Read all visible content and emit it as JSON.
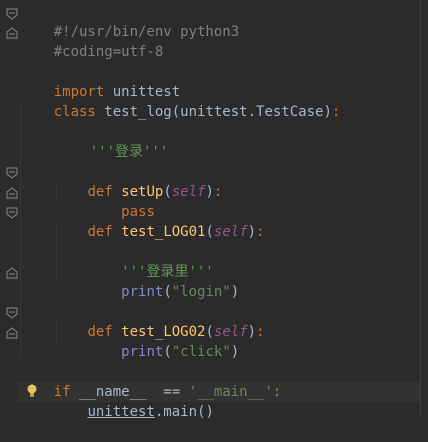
{
  "code": {
    "line1": {
      "text": "#!/usr/bin/env python3"
    },
    "line2": {
      "text": "#coding=utf-8"
    },
    "line4": {
      "kw": "import",
      "rest": " unittest"
    },
    "line5": {
      "kw": "class",
      "name": " test_log",
      "rest": "(unittest.TestCase)",
      "colon": ":"
    },
    "line7": {
      "doc": "'''登录'''"
    },
    "line9": {
      "indent": "    ",
      "kw": "def",
      "space": " ",
      "name": "setUp",
      "open": "(",
      "self": "self",
      "close": ")",
      "colon": ":"
    },
    "line10": {
      "indent": "        ",
      "kw": "pass"
    },
    "line11": {
      "indent": "    ",
      "kw": "def",
      "space": " ",
      "name": "test_LOG01",
      "open": "(",
      "self": "self",
      "close": ")",
      "colon": ":"
    },
    "line13": {
      "indent": "        ",
      "doc": "'''登录里'''"
    },
    "line14": {
      "indent": "        ",
      "builtin": "print",
      "open": "(",
      "str": "\"login\"",
      "close": ")"
    },
    "line16": {
      "indent": "    ",
      "kw": "def",
      "space": " ",
      "name": "test_LOG02",
      "open": "(",
      "self": "self",
      "close": ")",
      "colon": ":"
    },
    "line17": {
      "indent": "        ",
      "builtin": "print",
      "open": "(",
      "str": "\"click\"",
      "close": ")"
    },
    "line19": {
      "kw": "if",
      "mid": " __name__  == ",
      "str": "'__main__'",
      "colon": ":"
    },
    "line20": {
      "indent": "    ",
      "link": "unittest",
      "rest": ".main()"
    }
  },
  "colors": {
    "background": "#2b2b2b",
    "keyword": "#cc7832",
    "function": "#ffc66d",
    "self": "#94558d",
    "string": "#6a8759",
    "comment": "#808080",
    "text": "#a9b7c6"
  },
  "icons": {
    "fold": "fold-marker-icon",
    "bulb": "lightbulb-icon"
  }
}
